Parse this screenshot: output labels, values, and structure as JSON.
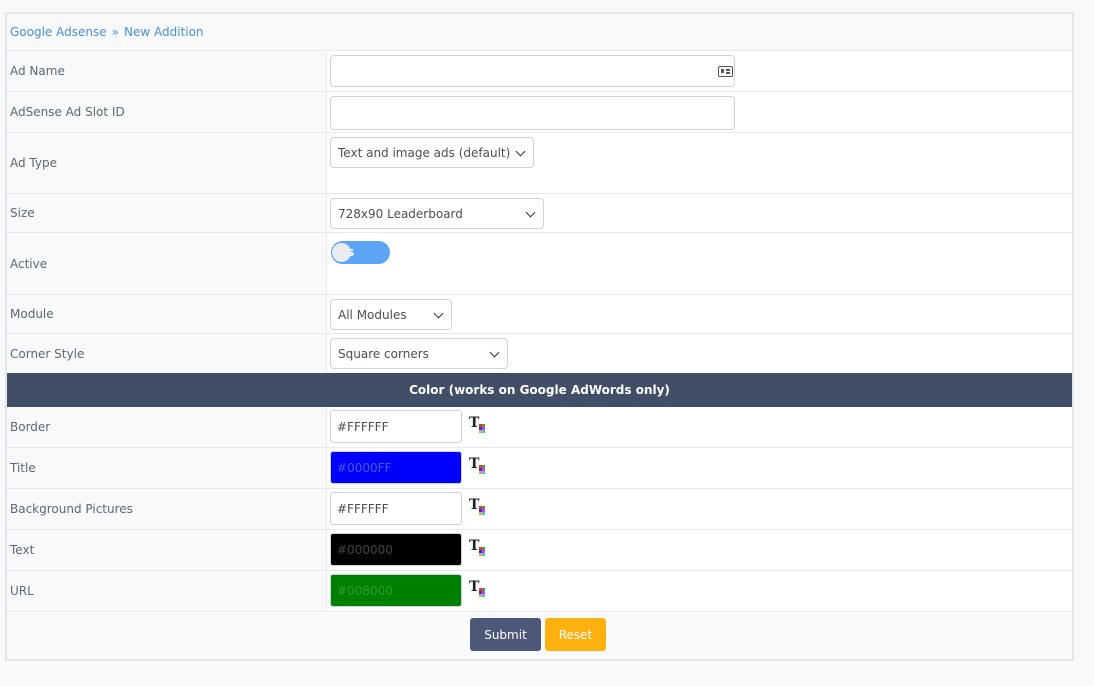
{
  "breadcrumb": {
    "root": "Google Adsense",
    "sep": "»",
    "current": "New Addition"
  },
  "fields": {
    "ad_name": {
      "label": "Ad Name",
      "value": ""
    },
    "slot_id": {
      "label": "AdSense Ad Slot ID",
      "value": ""
    },
    "ad_type": {
      "label": "Ad Type",
      "selected": "Text and image ads (default)"
    },
    "size": {
      "label": "Size",
      "selected": "728x90 Leaderboard"
    },
    "active": {
      "label": "Active",
      "toggle_text": "es",
      "on": true
    },
    "module": {
      "label": "Module",
      "selected": "All Modules"
    },
    "corner": {
      "label": "Corner Style",
      "selected": "Square corners"
    }
  },
  "color_section": {
    "title": "Color (works on Google AdWords only)",
    "rows": [
      {
        "label": "Border",
        "value": "#FFFFFF",
        "bg": "#FFFFFF",
        "fg": "#495057"
      },
      {
        "label": "Title",
        "value": "#0000FF",
        "bg": "#0000FF",
        "fg": "#4a5ad0"
      },
      {
        "label": "Background Pictures",
        "value": "#FFFFFF",
        "bg": "#FFFFFF",
        "fg": "#495057"
      },
      {
        "label": "Text",
        "value": "#000000",
        "bg": "#000000",
        "fg": "#444444"
      },
      {
        "label": "URL",
        "value": "#008000",
        "bg": "#008000",
        "fg": "#2f9a2f"
      }
    ],
    "picker_icon": "color-picker-icon"
  },
  "actions": {
    "submit": "Submit",
    "reset": "Reset"
  },
  "colors": {
    "submit_bg": "#4b5878",
    "reset_bg": "#ffb20f",
    "header_bg": "#414e68",
    "link": "#4a90d9"
  }
}
